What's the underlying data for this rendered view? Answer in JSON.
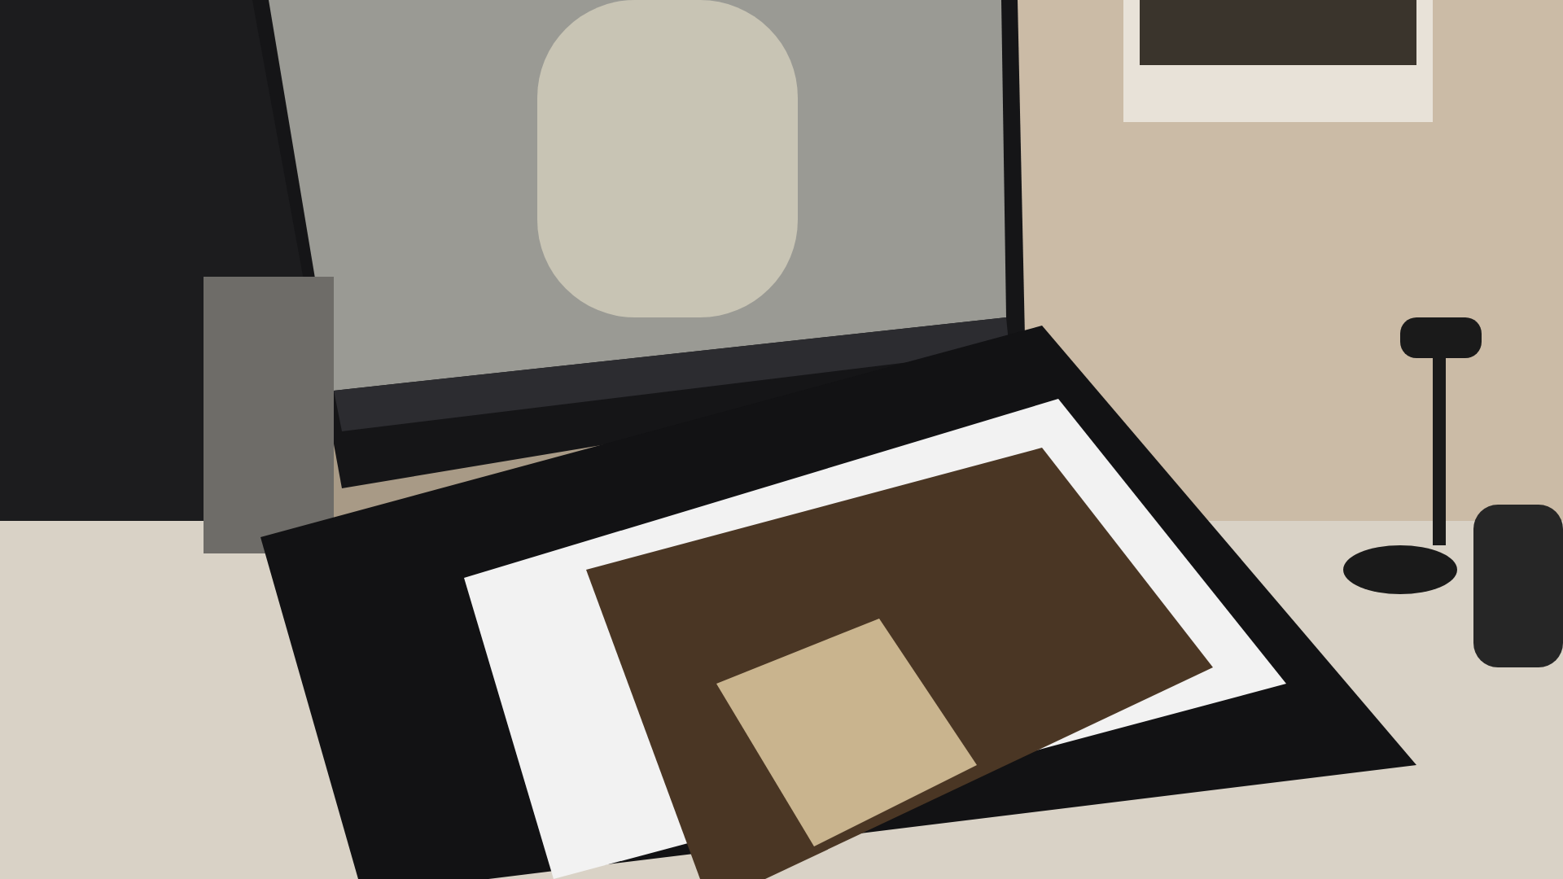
{
  "photo": {
    "kind": "desk-scene"
  }
}
